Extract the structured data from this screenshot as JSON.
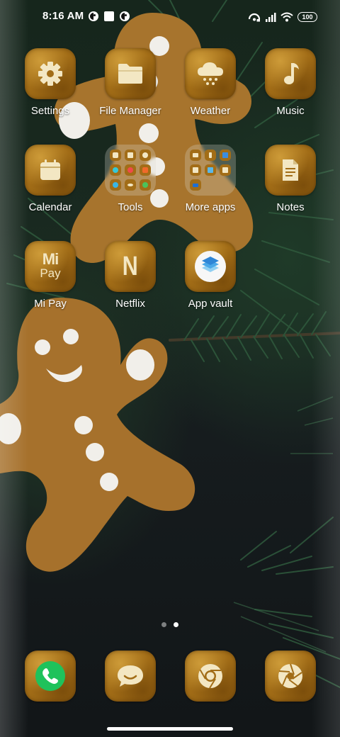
{
  "status_bar": {
    "time": "8:16 AM",
    "left_icons": [
      "notification-icon-1",
      "square-notification-icon",
      "notification-icon-2"
    ],
    "right_icons": [
      "hotspot-icon",
      "signal-icon",
      "wifi-icon"
    ],
    "battery": "100"
  },
  "home": {
    "rows": [
      [
        {
          "label": "Settings",
          "icon": "gear-icon"
        },
        {
          "label": "File Manager",
          "icon": "folder-icon"
        },
        {
          "label": "Weather",
          "icon": "cloud-snow-icon"
        },
        {
          "label": "Music",
          "icon": "music-note-icon"
        }
      ],
      [
        {
          "label": "Calendar",
          "icon": "calendar-icon"
        },
        {
          "label": "Tools",
          "icon": "folder-group-icon"
        },
        {
          "label": "More apps",
          "icon": "folder-group-icon"
        },
        {
          "label": "Notes",
          "icon": "notes-icon"
        }
      ],
      [
        {
          "label": "Mi Pay",
          "icon": "mi-pay-icon",
          "glyph_top": "Mi",
          "glyph_bottom": "Pay"
        },
        {
          "label": "Netflix",
          "icon": "netflix-icon",
          "glyph": "N"
        },
        {
          "label": "App vault",
          "icon": "app-vault-icon"
        }
      ]
    ]
  },
  "page_indicator": {
    "pages": 2,
    "current": 2
  },
  "dock": [
    {
      "name": "phone",
      "icon": "phone-icon"
    },
    {
      "name": "messaging",
      "icon": "chat-bubble-icon"
    },
    {
      "name": "browser",
      "icon": "chrome-icon"
    },
    {
      "name": "camera",
      "icon": "camera-aperture-icon"
    }
  ],
  "colors": {
    "icon_base": "#a26d17",
    "icon_glyph": "#f3e7c3",
    "phone_green": "#1fc25b",
    "text": "#ffffff"
  }
}
